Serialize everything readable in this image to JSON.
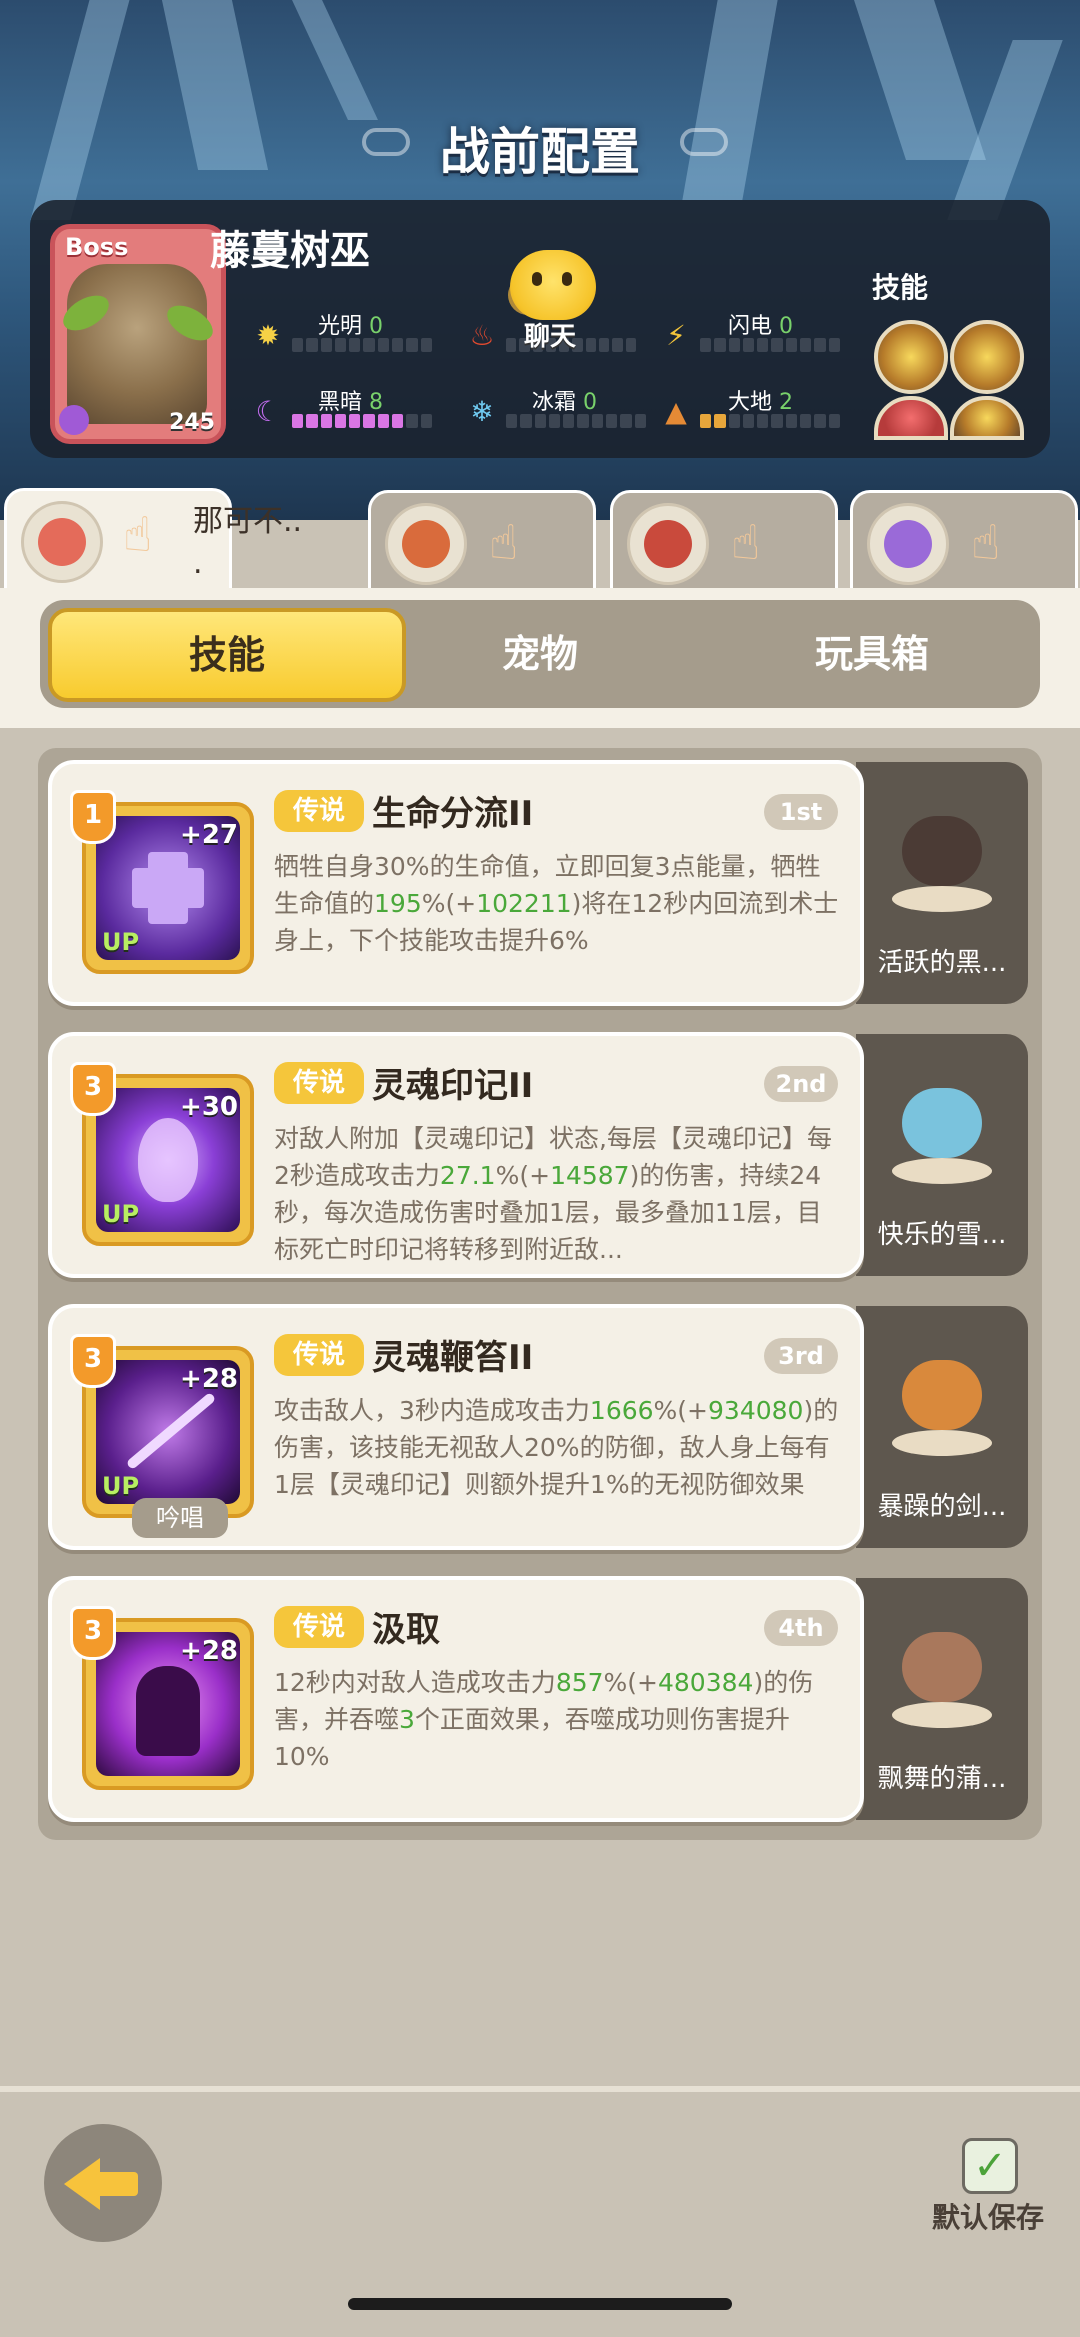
{
  "header": {
    "title": "战前配置"
  },
  "boss": {
    "tag": "Boss",
    "name": "藤蔓树巫",
    "level": "245",
    "elements": [
      {
        "label": "光明",
        "value": "0",
        "icon": "sun-icon"
      },
      {
        "label": "黑暗",
        "value": "8",
        "icon": "moon-icon"
      },
      {
        "label": "冰霜",
        "value": "0",
        "icon": "snowflake-icon"
      },
      {
        "label": "闪电",
        "value": "0",
        "icon": "lightning-icon"
      },
      {
        "label": "大地",
        "value": "2",
        "icon": "earth-icon"
      },
      {
        "label": "火焰",
        "value": "",
        "icon": "fire-icon"
      }
    ],
    "skills_label": "技能"
  },
  "chat": {
    "label": "聊天"
  },
  "hero_tabs": [
    {
      "name": "那可不..\n.",
      "active": true
    },
    {
      "name": "",
      "active": false
    },
    {
      "name": "",
      "active": false
    },
    {
      "name": "",
      "active": false
    }
  ],
  "tabs": [
    {
      "label": "技能",
      "active": true
    },
    {
      "label": "宠物",
      "active": false
    },
    {
      "label": "玩具箱",
      "active": false
    }
  ],
  "skills": [
    {
      "rank": "1",
      "plus": "+27",
      "up": "UP",
      "rarity": "传说",
      "name": "生命分流II",
      "order": "1st",
      "desc_parts": [
        "牺牲自身30%的生命值，立即回复3点能量，牺牲生命值的",
        "195",
        "%(+",
        "102211",
        ")将在12秒内回流到术士身上，下个技能攻击提升6%"
      ],
      "pet": "活跃的黑..."
    },
    {
      "rank": "3",
      "plus": "+30",
      "up": "UP",
      "rarity": "传说",
      "name": "灵魂印记II",
      "order": "2nd",
      "desc_parts": [
        "对敌人附加【灵魂印记】状态,每层【灵魂印记】每2秒造成攻击力",
        "27.1",
        "%(+",
        "14587",
        ")的伤害，持续24秒，每次造成伤害时叠加1层，最多叠加11层，目标死亡时印记将转移到附近敌..."
      ],
      "pet": "快乐的雪..."
    },
    {
      "rank": "3",
      "plus": "+28",
      "up": "UP",
      "rarity": "传说",
      "name": "灵魂鞭笞II",
      "order": "3rd",
      "desc_parts": [
        "攻击敌人，3秒内造成攻击力",
        "1666",
        "%(+",
        "934080",
        ")的伤害，该技能无视敌人20%的防御，敌人身上每有1层【灵魂印记】则额外提升1%的无视防御效果"
      ],
      "chant": "吟唱",
      "pet": "暴躁的剑..."
    },
    {
      "rank": "3",
      "plus": "+28",
      "up": "",
      "rarity": "传说",
      "name": "汲取",
      "order": "4th",
      "desc_parts": [
        "12秒内对敌人造成攻击力",
        "857",
        "%(+",
        "480384",
        ")的伤害，并吞噬",
        "3",
        "个正面效果，吞噬成功则伤害提升10%"
      ],
      "pet": "飘舞的蒲..."
    }
  ],
  "footer": {
    "save_label": "默认保存",
    "save_checked": true
  }
}
